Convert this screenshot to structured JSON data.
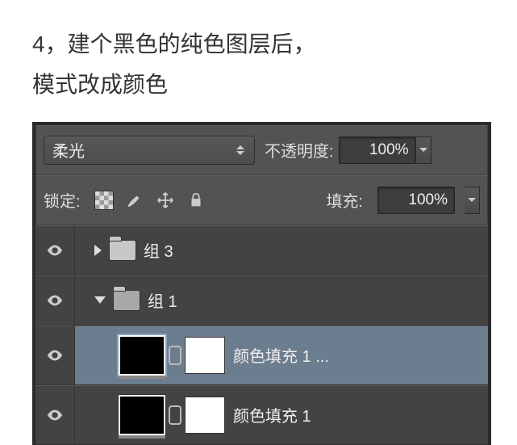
{
  "instruction": {
    "line1": "4，建个黑色的纯色图层后，",
    "line2": "模式改成颜色"
  },
  "panel": {
    "blend_mode": "柔光",
    "opacity_label": "不透明度:",
    "opacity_value": "100%",
    "lock_label": "锁定:",
    "fill_label": "填充:",
    "fill_value": "100%"
  },
  "layers": [
    {
      "type": "group",
      "name": "组 3",
      "expanded": false,
      "indent": 1
    },
    {
      "type": "group",
      "name": "组 1",
      "expanded": true,
      "indent": 1
    },
    {
      "type": "fill",
      "name": "颜色填充 1 ...",
      "indent": 2,
      "selected": true
    },
    {
      "type": "fill",
      "name": "颜色填充 1",
      "indent": 2,
      "selected": false
    }
  ]
}
